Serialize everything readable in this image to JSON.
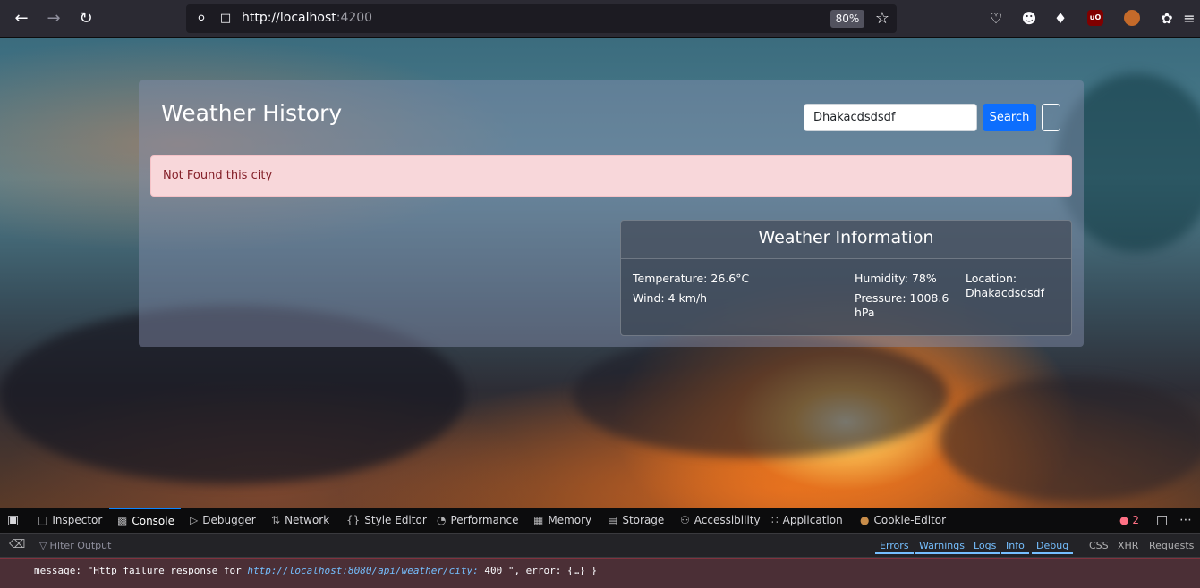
{
  "browser": {
    "url_host": "http://localhost",
    "url_port": ":4200",
    "zoom": "80%"
  },
  "page": {
    "title": "Weather History",
    "search": {
      "value": "Dhakacdsdsdf",
      "button_label": "Search"
    },
    "alert_text": "Not Found this city",
    "weather_card": {
      "title": "Weather Information",
      "temperature": "Temperature: 26.6°C",
      "wind": "Wind: 4 km/h",
      "humidity": "Humidity: 78%",
      "pressure": "Pressure: 1008.6 hPa",
      "location": "Location: Dhakacdsdsdf"
    }
  },
  "devtools": {
    "tabs": [
      "Inspector",
      "Console",
      "Debugger",
      "Network",
      "Style Editor",
      "Performance",
      "Memory",
      "Storage",
      "Accessibility",
      "Application",
      "Cookie-Editor"
    ],
    "active_tab": "Console",
    "error_count": "2",
    "filter_placeholder": "Filter Output",
    "levels": [
      "Errors",
      "Warnings",
      "Logs",
      "Info",
      "Debug"
    ],
    "request_filters": [
      "CSS",
      "XHR",
      "Requests"
    ],
    "error_message_prefix": "message: \"Http failure response for ",
    "error_url": "http://localhost:8080/api/weather/city:",
    "error_message_suffix": " 400 \", error: {…} }"
  }
}
